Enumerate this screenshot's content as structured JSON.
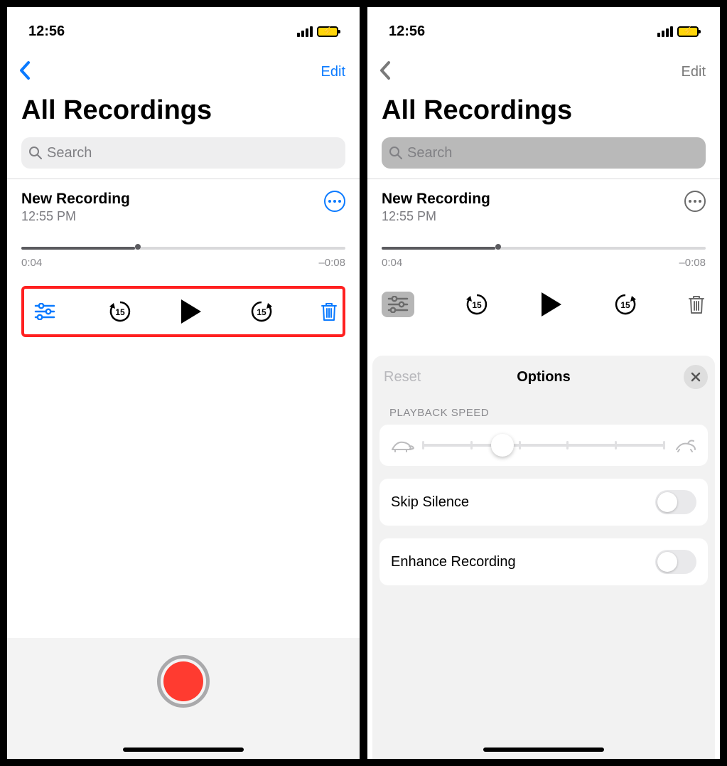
{
  "status": {
    "time": "12:56"
  },
  "nav": {
    "edit": "Edit"
  },
  "title": "All Recordings",
  "search": {
    "placeholder": "Search"
  },
  "recording": {
    "title": "New Recording",
    "subtitle": "12:55 PM",
    "elapsed": "0:04",
    "remaining": "–0:08",
    "progress_pct": 33
  },
  "controls": {
    "skip_seconds": "15"
  },
  "options": {
    "reset": "Reset",
    "title": "Options",
    "section_speed": "PLAYBACK SPEED",
    "skip_silence": "Skip Silence",
    "enhance": "Enhance Recording"
  }
}
